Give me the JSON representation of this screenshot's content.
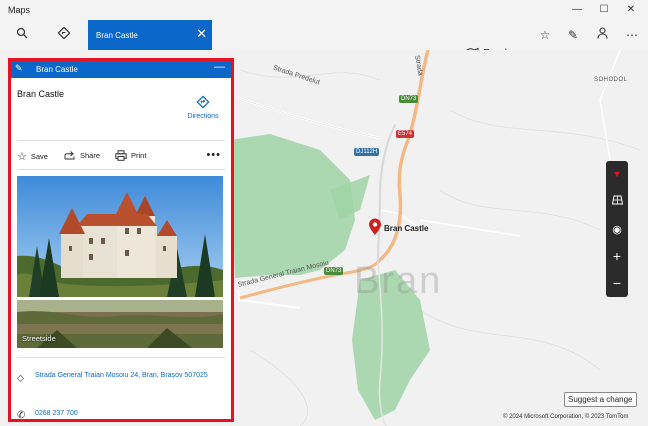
{
  "window": {
    "title": "Maps"
  },
  "toolbar": {
    "search_tab_label": "Bran Castle",
    "map_style": "Road"
  },
  "panel": {
    "header_title": "Bran Castle",
    "place_title": "Bran Castle",
    "directions_label": "Directions",
    "actions": {
      "save": "Save",
      "share": "Share",
      "print": "Print"
    },
    "streetside_label": "Streetside",
    "address": "Strada General Traian Mosoiu 24, Bran, Brașov 507025",
    "phone": "0268 237 700"
  },
  "map": {
    "place_label": "Bran Castle",
    "town_label": "Bran",
    "labels": {
      "predelut": "Strada Predelut",
      "strada": "Strada",
      "sohodol": "SOHODOL",
      "traian": "Strada General Traian Mosoiu"
    },
    "shields": {
      "dn73_top": "DN73",
      "e574": "E574",
      "dj112h": "DJ112H",
      "dn73_bottom": "DN73"
    }
  },
  "footer": {
    "suggest_label": "Suggest a change",
    "copyright": "© 2024 Microsoft Corporation, © 2023 TomTom"
  },
  "colors": {
    "accent": "#0b67c9",
    "highlight_border": "#e81123",
    "park": "#9fd3a6",
    "road": "#f3b984"
  }
}
